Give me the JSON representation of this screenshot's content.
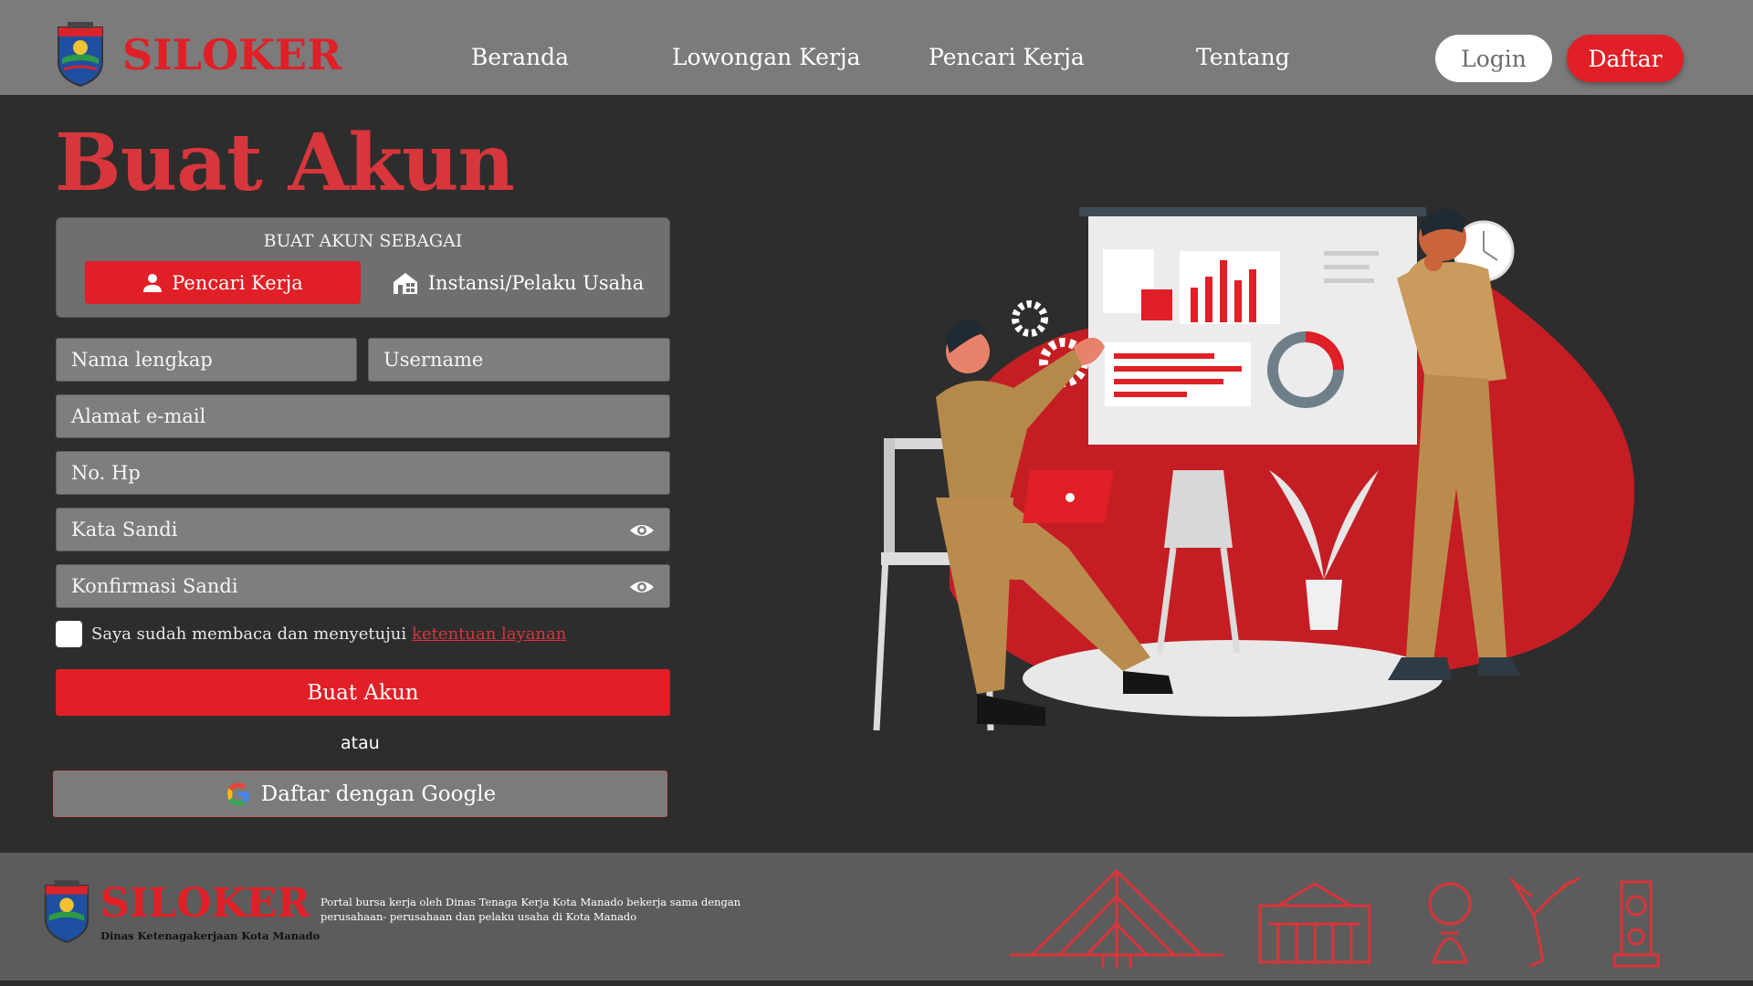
{
  "header": {
    "brand": "SILOKER",
    "nav": [
      "Beranda",
      "Lowongan Kerja",
      "Pencari Kerja",
      "Tentang"
    ],
    "login_label": "Login",
    "register_label": "Daftar"
  },
  "main": {
    "title": "Buat Akun",
    "role": {
      "caption": "BUAT AKUN SEBAGAI",
      "options": [
        "Pencari Kerja",
        "Instansi/Pelaku Usaha"
      ],
      "selected": "Pencari Kerja"
    },
    "fields": {
      "fullname_placeholder": "Nama lengkap",
      "username_placeholder": "Username",
      "email_placeholder": "Alamat e-mail",
      "phone_placeholder": "No. Hp",
      "password_placeholder": "Kata Sandi",
      "confirm_placeholder": "Konfirmasi Sandi"
    },
    "terms": {
      "text": "Saya sudah membaca dan menyetujui",
      "link": "ketentuan layanan"
    },
    "submit_label": "Buat Akun",
    "separator": "atau",
    "google_label": "Daftar dengan Google"
  },
  "footer": {
    "brand": "SILOKER",
    "subtitle": "Dinas Ketenagakerjaan Kota Manado",
    "description": "Portal bursa kerja oleh Dinas Tenaga Kerja Kota Manado bekerja sama dengan perusahaan- perusahaan dan pelaku usaha di Kota Manado"
  },
  "colors": {
    "accent": "#e01f26",
    "header_bg": "#7b7b7b",
    "page_bg": "#2d2d2d",
    "footer_bg": "#5c5c5c"
  }
}
